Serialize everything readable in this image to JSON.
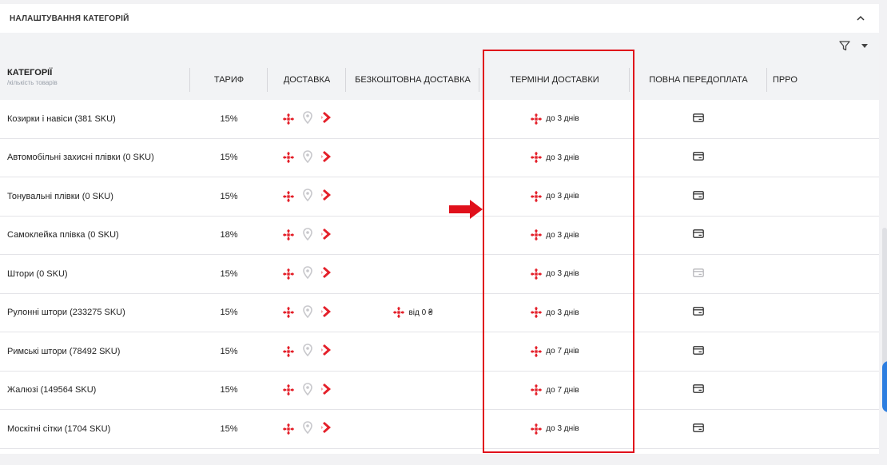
{
  "panel": {
    "title": "НАЛАШТУВАННЯ КАТЕГОРІЙ",
    "collapse_icon": "chevron-up-icon"
  },
  "filter": {
    "icon": "filter-icon",
    "dropdown_icon": "caret-down-icon"
  },
  "columns": {
    "category": "КАТЕГОРІЇ",
    "category_sub": "/кількість товарів",
    "tariff": "ТАРИФ",
    "delivery": "ДОСТАВКА",
    "free_delivery": "БЕЗКОШТОВНА ДОСТАВКА",
    "terms": "ТЕРМІНИ ДОСТАВКИ",
    "prepay": "ПОВНА ПЕРЕДОПЛАТА",
    "pro": "ПРРО"
  },
  "rows": [
    {
      "category": "Козирки і навіси (381 SKU)",
      "tariff": "15%",
      "free": "",
      "term": "до 3 днів",
      "prepay_enabled": true
    },
    {
      "category": "Автомобільні захисні плівки (0 SKU)",
      "tariff": "15%",
      "free": "",
      "term": "до 3 днів",
      "prepay_enabled": true
    },
    {
      "category": "Тонувальні плівки (0 SKU)",
      "tariff": "15%",
      "free": "",
      "term": "до 3 днів",
      "prepay_enabled": true
    },
    {
      "category": "Самоклейка плівка (0 SKU)",
      "tariff": "18%",
      "free": "",
      "term": "до 3 днів",
      "prepay_enabled": true
    },
    {
      "category": "Штори (0 SKU)",
      "tariff": "15%",
      "free": "",
      "term": "до 3 днів",
      "prepay_enabled": false
    },
    {
      "category": "Рулонні штори (233275 SKU)",
      "tariff": "15%",
      "free": "від 0 ₴",
      "term": "до 3 днів",
      "prepay_enabled": true
    },
    {
      "category": "Римські штори (78492 SKU)",
      "tariff": "15%",
      "free": "",
      "term": "до 7 днів",
      "prepay_enabled": true
    },
    {
      "category": "Жалюзі (149564 SKU)",
      "tariff": "15%",
      "free": "",
      "term": "до 7 днів",
      "prepay_enabled": true
    },
    {
      "category": "Москітні сітки (1704 SKU)",
      "tariff": "15%",
      "free": "",
      "term": "до 3 днів",
      "prepay_enabled": true
    }
  ],
  "colors": {
    "accent_red": "#e0101b",
    "nova_red": "#e4202a",
    "header_bg": "#f2f3f5"
  }
}
